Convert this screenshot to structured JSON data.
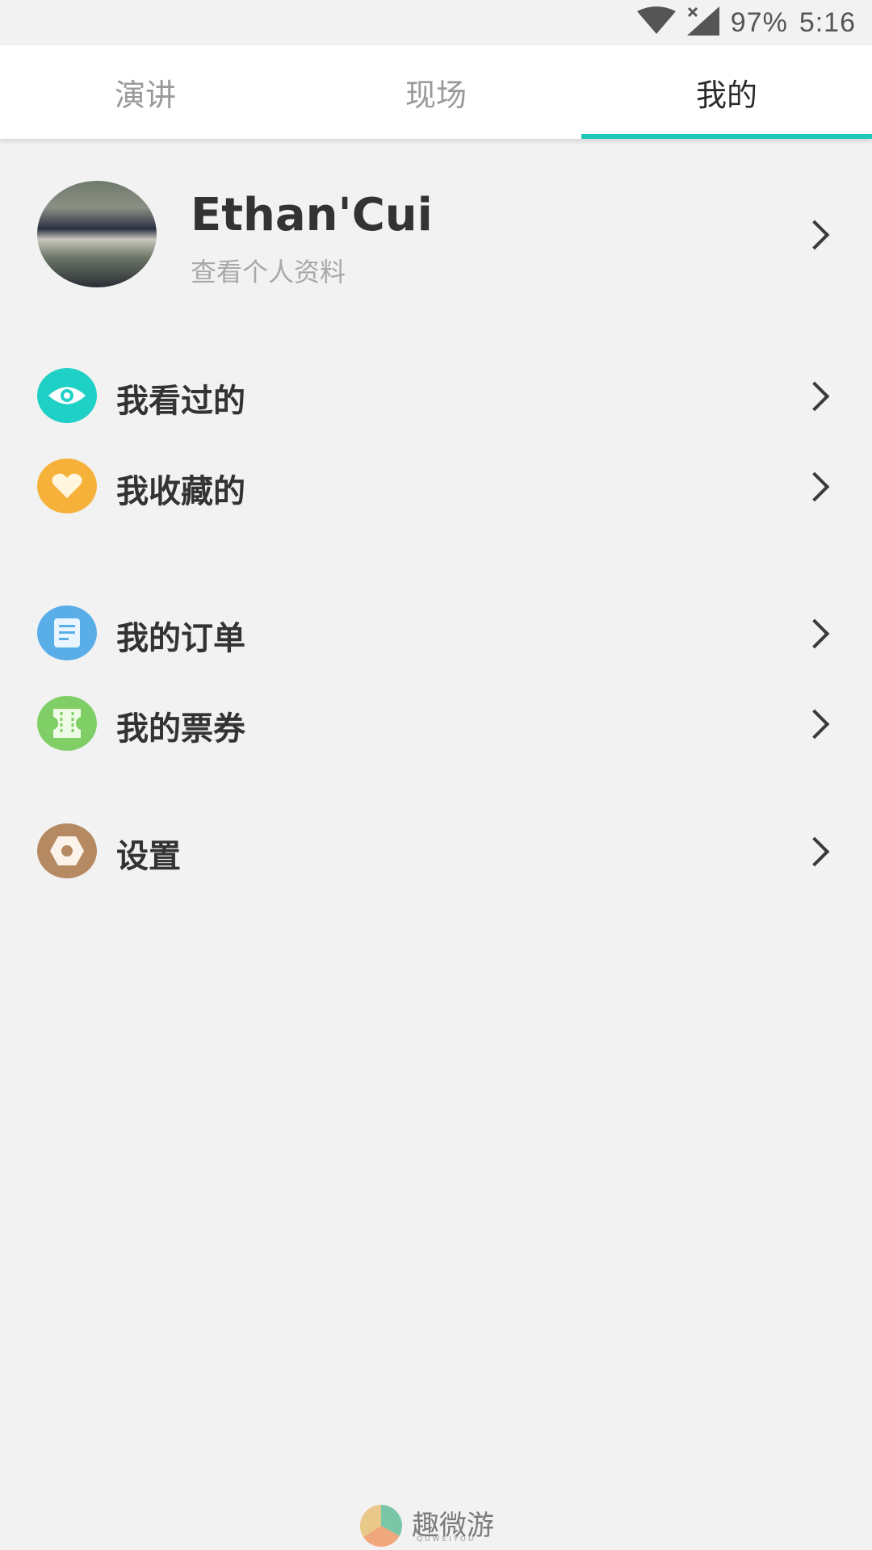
{
  "status_bar": {
    "battery": "97%",
    "time": "5:16"
  },
  "tabs": [
    {
      "label": "演讲",
      "active": false
    },
    {
      "label": "现场",
      "active": false
    },
    {
      "label": "我的",
      "active": true
    }
  ],
  "accent_color": "#1ec7b7",
  "profile": {
    "name": "Ethan'Cui",
    "subtitle": "查看个人资料"
  },
  "menu": {
    "watched": {
      "label": "我看过的",
      "icon": "eye-icon",
      "color": "#1fd0c6"
    },
    "favorites": {
      "label": "我收藏的",
      "icon": "heart-icon",
      "color": "#f6b13a"
    },
    "orders": {
      "label": "我的订单",
      "icon": "document-icon",
      "color": "#5aaee8"
    },
    "tickets": {
      "label": "我的票券",
      "icon": "ticket-icon",
      "color": "#80cf66"
    },
    "settings": {
      "label": "设置",
      "icon": "hexagon-nut-icon",
      "color": "#b58a62"
    }
  },
  "footer": {
    "brand": "趣微游",
    "brand_sub": "QUWEIYOU"
  }
}
